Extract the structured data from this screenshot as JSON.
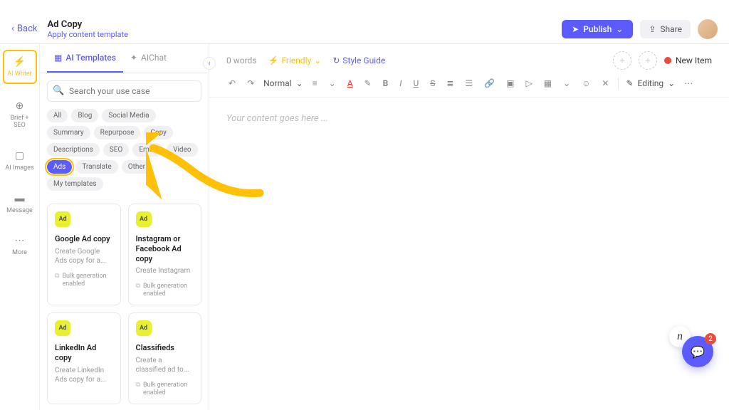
{
  "header": {
    "back": "Back",
    "title": "Ad Copy",
    "subtitle": "Apply content template",
    "publish": "Publish",
    "share": "Share"
  },
  "rail": {
    "items": [
      {
        "label": "AI Writer",
        "icon": "⚡"
      },
      {
        "label": "Brief + SEO",
        "icon": "⊕"
      },
      {
        "label": "AI Images",
        "icon": "▢"
      },
      {
        "label": "Message",
        "icon": "▬"
      },
      {
        "label": "More",
        "icon": "⋯"
      }
    ]
  },
  "panel": {
    "tabs": [
      {
        "label": "AI Templates",
        "active": true
      },
      {
        "label": "AIChat",
        "active": false
      }
    ],
    "search_placeholder": "Search your use case",
    "chips": [
      "All",
      "Blog",
      "Social Media",
      "Summary",
      "Repurpose",
      "Copy",
      "Descriptions",
      "SEO",
      "Email",
      "Video",
      "Ads",
      "Translate",
      "Other",
      "My templates"
    ],
    "chip_active": "Ads",
    "cards": [
      {
        "icon": "Ad",
        "title": "Google Ad copy",
        "desc": "Create Google Ads copy for a...",
        "bulk": "Bulk generation enabled"
      },
      {
        "icon": "Ad",
        "title": "Instagram or Facebook Ad copy",
        "desc": "Create Instagram",
        "bulk": "Bulk generation enabled"
      },
      {
        "icon": "Ad",
        "title": "LinkedIn Ad copy",
        "desc": "Create LinkedIn Ads copy for a...",
        "bulk": ""
      },
      {
        "icon": "Ad",
        "title": "Classifieds",
        "desc": "Create a classified ad to...",
        "bulk": "Bulk generation enabled"
      }
    ]
  },
  "editor": {
    "wordcount": "0 words",
    "friendly": "Friendly",
    "styleguide": "Style Guide",
    "newitem": "New Item",
    "format": "Normal",
    "editing": "Editing",
    "placeholder": "Your content goes here ..."
  },
  "fab": {
    "badge": "2",
    "n": "n"
  }
}
